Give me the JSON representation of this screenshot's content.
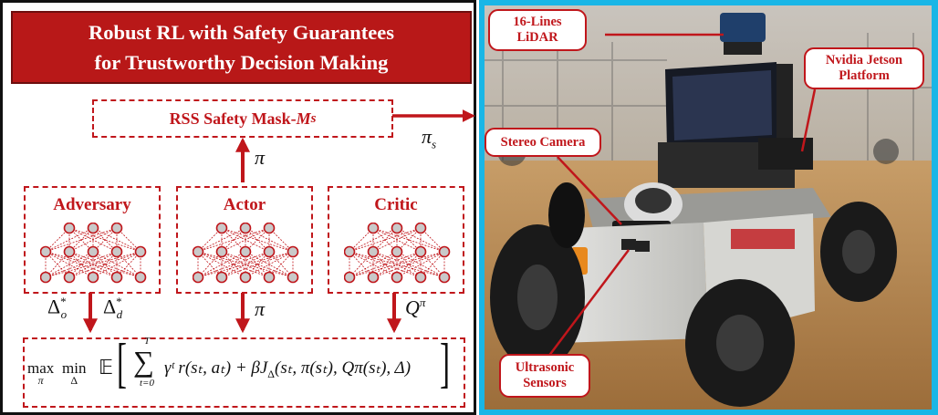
{
  "title": {
    "line1": "Robust RL with Safety Guarantees",
    "line2": "for Trustworthy Decision Making"
  },
  "mask": {
    "label": "RSS Safety Mask-",
    "symbol": "M",
    "subscript": "s"
  },
  "networks": [
    {
      "id": "adversary",
      "label": "Adversary"
    },
    {
      "id": "actor",
      "label": "Actor"
    },
    {
      "id": "critic",
      "label": "Critic"
    }
  ],
  "math": {
    "pi": "π",
    "pi_s": "π",
    "pi_s_sub": "s",
    "delta": "Δ",
    "delta_o_sub": "o",
    "delta_d_sub": "d",
    "star": "*",
    "q": "Q",
    "q_sup": "π"
  },
  "formula": {
    "max": "max",
    "max_sub": "π",
    "min": "min",
    "min_sub": "Δ",
    "expect": "𝔼",
    "sum_top": "T",
    "sum_bottom": "t=0",
    "body": "γᵗ r(sₜ, aₜ) + βJ",
    "body_sub": "Δ",
    "args": "(sₜ, π(sₜ), Qπ(sₜ), Δ)"
  },
  "callouts": {
    "lidar": [
      "16-Lines",
      "LiDAR"
    ],
    "jetson": [
      "Nvidia Jetson",
      "Platform"
    ],
    "stereo": [
      "Stereo Camera"
    ],
    "ultrasonic": [
      "Ultrasonic",
      "Sensors"
    ]
  },
  "colors": {
    "accent": "#c0161b",
    "banner": "#b81818",
    "frame": "#19b6e6"
  }
}
